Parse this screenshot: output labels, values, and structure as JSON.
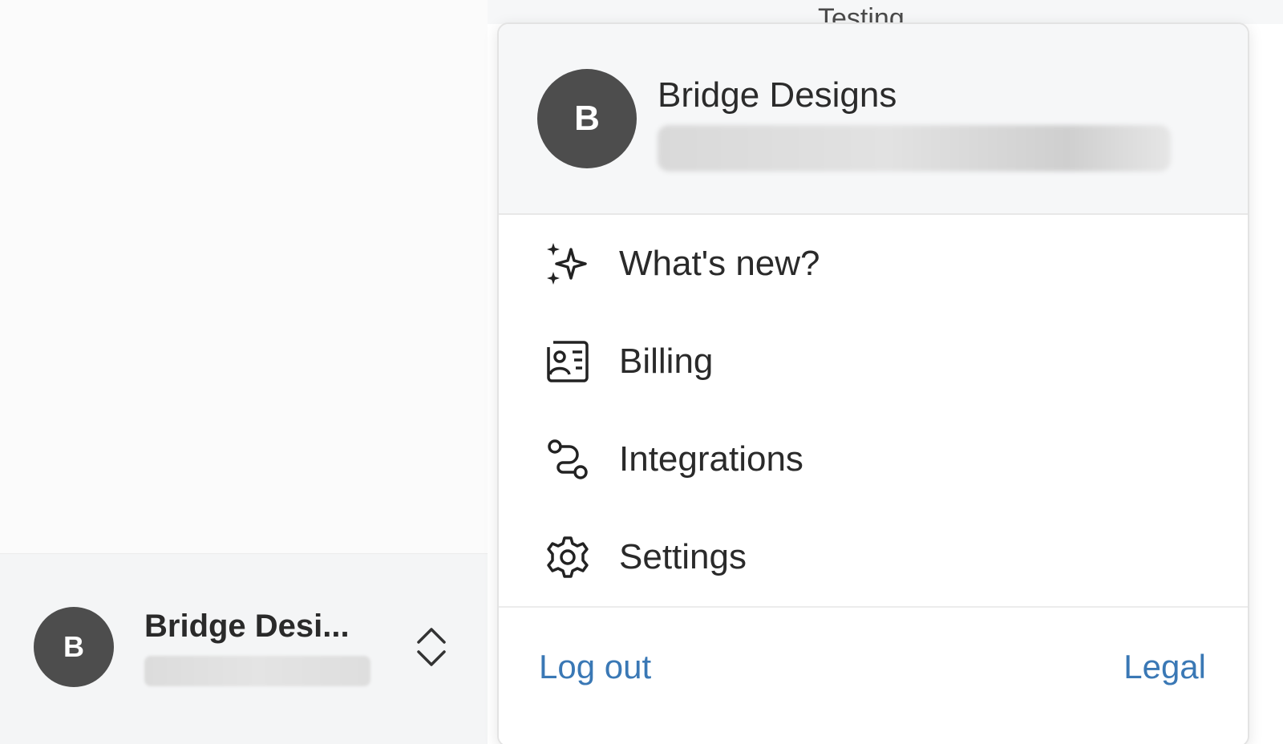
{
  "sidebar": {
    "account": {
      "avatar_initial": "B",
      "name": "Bridge Desi..."
    }
  },
  "header": {
    "partial_text": "Testing"
  },
  "popover": {
    "avatar_initial": "B",
    "name": "Bridge Designs",
    "menu": [
      {
        "label": "What's new?",
        "icon": "sparkle-icon"
      },
      {
        "label": "Billing",
        "icon": "billing-icon"
      },
      {
        "label": "Integrations",
        "icon": "integrations-icon"
      },
      {
        "label": "Settings",
        "icon": "gear-icon"
      }
    ],
    "footer": {
      "logout_label": "Log out",
      "legal_label": "Legal"
    }
  },
  "colors": {
    "avatar": "#4d4d4d",
    "link": "#3a78b5",
    "text": "#2a2a2a"
  }
}
